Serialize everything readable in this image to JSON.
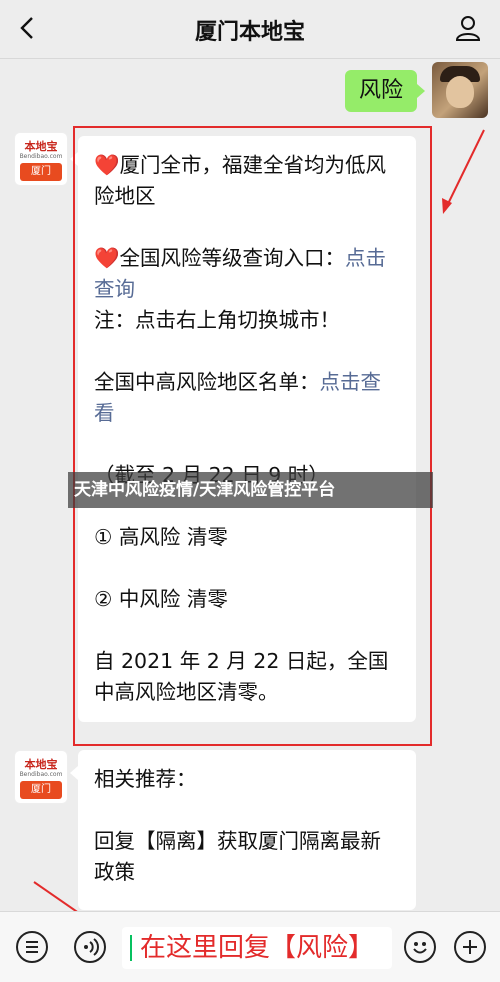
{
  "header": {
    "title": "厦门本地宝"
  },
  "messages": {
    "me": {
      "text": "风险"
    },
    "bot_avatar": {
      "top": "本地宝",
      "mid": "Bendibao.com",
      "city": "厦门"
    },
    "bot1": {
      "line1_heart": "❤️",
      "line1": "厦门全市，福建全省均为低风险地区",
      "line2_heart": "❤️",
      "line2_text": "全国风险等级查询入口：",
      "line2_link": "点击查询",
      "line3": "注：点击右上角切换城市！",
      "line4_text": "全国中高风险地区名单：",
      "line4_link": "点击查看",
      "line5": "（截至 2 月 22 日 9 时）",
      "line6": "① 高风险 清零",
      "line7": "② 中风险 清零",
      "line8": "自 2021 年 2 月 22 日起，全国中高风险地区清零。"
    },
    "bot2": {
      "line1": "相关推荐：",
      "line2": "回复【隔离】获取厦门隔离最新政策"
    }
  },
  "overlay": {
    "banner": "天津中风险疫情/天津风险管控平台"
  },
  "input": {
    "text": "在这里回复【风险】"
  },
  "colors": {
    "accent_red": "#e32b2b",
    "link": "#576b95",
    "bubble_green": "#95ec69"
  }
}
